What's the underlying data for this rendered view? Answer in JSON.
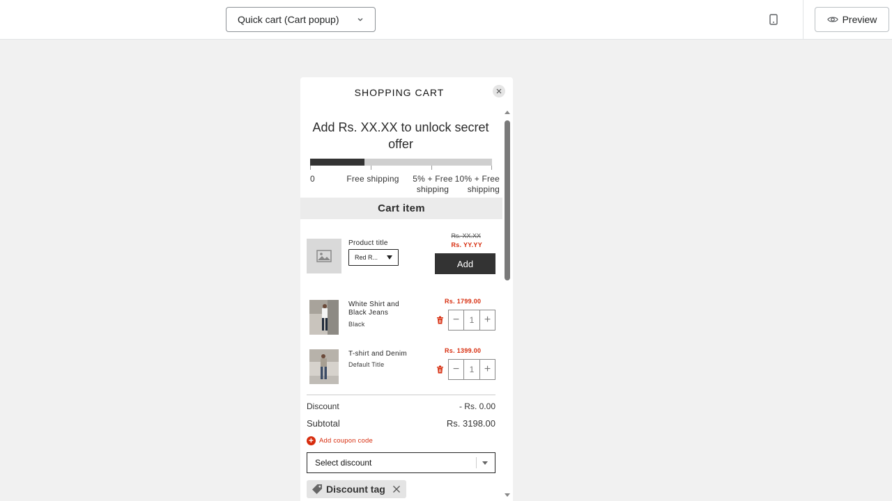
{
  "toolbar": {
    "template_select": "Quick cart (Cart popup)",
    "preview_label": "Preview"
  },
  "cart": {
    "title": "SHOPPING CART",
    "offer_message": "Add Rs. XX.XX to unlock secret offer",
    "progress_fraction": 0.3,
    "milestones": [
      "0",
      "Free shipping",
      "5% + Free shipping",
      "10% + Free shipping"
    ],
    "section_title": "Cart item",
    "upsell": {
      "title": "Product title",
      "variant": "Red R...",
      "compare_price": "Rs. XX.XX",
      "price": "Rs. YY.YY",
      "add_label": "Add"
    },
    "items": [
      {
        "title": "White Shirt and Black Jeans",
        "variant": "Black",
        "price": "Rs. 1799.00",
        "qty": "1"
      },
      {
        "title": "T-shirt and Denim",
        "variant": "Default Title",
        "price": "Rs. 1399.00",
        "qty": "1"
      }
    ],
    "discount_label": "Discount",
    "discount_value": "- Rs. 0.00",
    "subtotal_label": "Subtotal",
    "subtotal_value": "Rs. 3198.00",
    "coupon_link": "Add coupon code",
    "discount_select": "Select discount",
    "discount_tag": "Discount tag"
  },
  "colors": {
    "accent_red": "#d72c0d",
    "dark_button": "#333333"
  }
}
